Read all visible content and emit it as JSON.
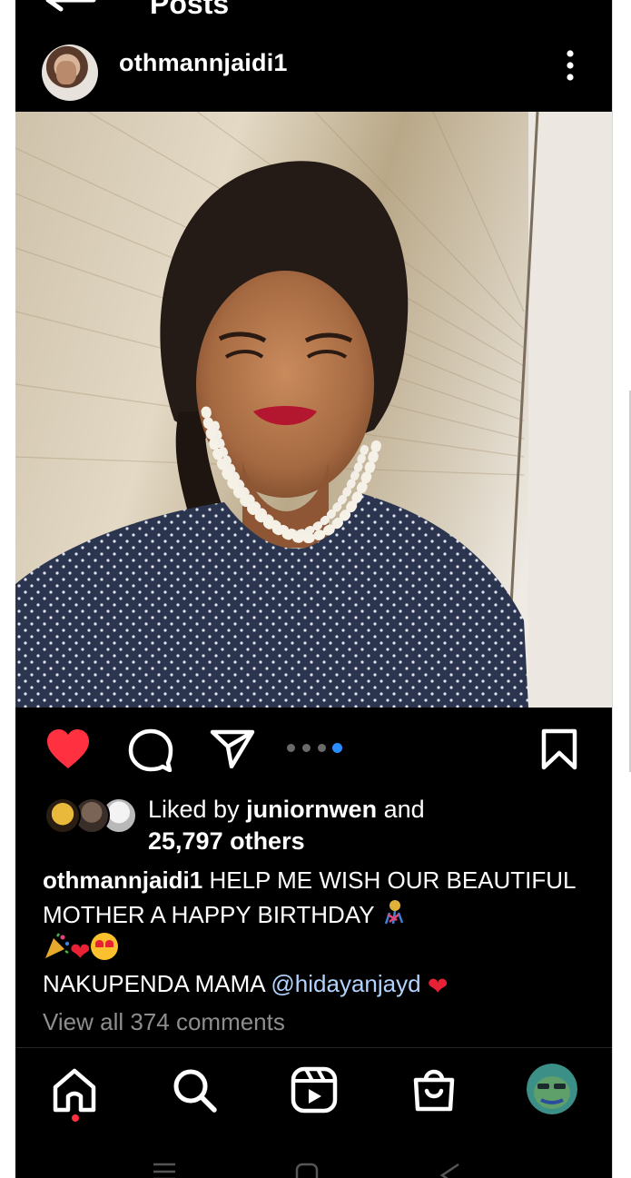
{
  "header": {
    "title": "Posts"
  },
  "post": {
    "username": "othmannjaidi1",
    "carousel": {
      "count": 4,
      "active_index": 3
    },
    "liked": true,
    "likes": {
      "prefix": "Liked by ",
      "liker": "juniornwen",
      "middle": " and",
      "others": "25,797 others"
    },
    "caption": {
      "user": "othmannjaidi1",
      "text": " HELP ME WISH OUR BEAUTIFUL MOTHER A HAPPY BIRTHDAY ",
      "line2_prefix": " NAKUPENDA MAMA ",
      "mention": "@hidayanjayd"
    },
    "view_comments": "View all 374 comments"
  },
  "colors": {
    "like": "#ff3040",
    "carousel_active": "#2b8cff",
    "mention": "#b3d3ff",
    "muted": "#8e8e8e"
  },
  "icons": {
    "header": [
      "back-arrow-icon"
    ],
    "actions": [
      "heart-icon",
      "comment-icon",
      "share-icon",
      "bookmark-icon",
      "more-options-icon"
    ],
    "nav": [
      "home-icon",
      "search-icon",
      "reels-icon",
      "shop-icon",
      "profile-avatar"
    ]
  }
}
